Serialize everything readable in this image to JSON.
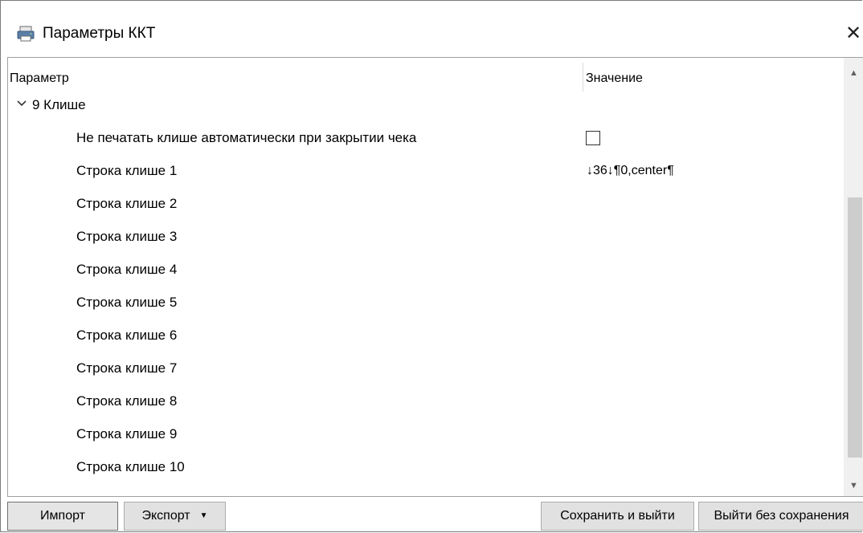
{
  "window": {
    "title": "Параметры ККТ",
    "icon": "printer-icon",
    "close_glyph": "✕"
  },
  "grid": {
    "columns": [
      "Параметр",
      "Значение"
    ],
    "group": {
      "label": "9 Клише",
      "expanded": true
    },
    "rows": [
      {
        "label": "Не печатать клише автоматически при закрытии чека",
        "type": "checkbox",
        "checked": false
      },
      {
        "label": "Строка клише 1",
        "value": "↓36↓¶0,center¶"
      },
      {
        "label": "Строка клише 2",
        "value": ""
      },
      {
        "label": "Строка клише 3",
        "value": ""
      },
      {
        "label": "Строка клише 4",
        "value": ""
      },
      {
        "label": "Строка клише 5",
        "value": ""
      },
      {
        "label": "Строка клише 6",
        "value": ""
      },
      {
        "label": "Строка клише 7",
        "value": ""
      },
      {
        "label": "Строка клише 8",
        "value": ""
      },
      {
        "label": "Строка клише 9",
        "value": ""
      },
      {
        "label": "Строка клише 10",
        "value": ""
      }
    ]
  },
  "buttons": {
    "import": "Импорт",
    "export": "Экспорт",
    "export_arrow": "▼",
    "save_exit": "Сохранить и выйти",
    "exit_no_save": "Выйти без сохранения"
  },
  "scrollbar": {
    "up": "▲",
    "down": "▼"
  }
}
